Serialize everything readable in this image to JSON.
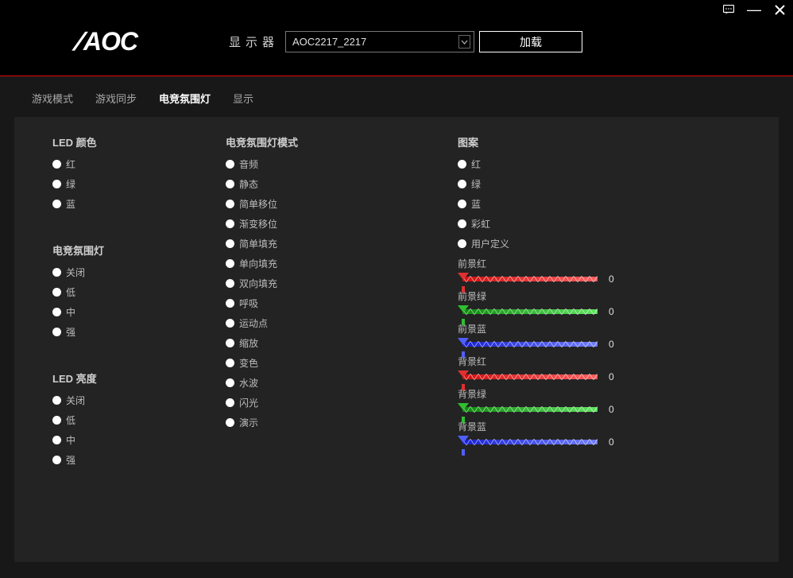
{
  "window": {
    "feedback_icon": "feedback",
    "minimize": "—",
    "close": "✕"
  },
  "header": {
    "logo": "AOC",
    "monitor_label": "显示器",
    "monitor_value": "AOC2217_2217",
    "load_button": "加载"
  },
  "tabs": [
    {
      "id": "game-mode",
      "label": "游戏模式",
      "active": false
    },
    {
      "id": "game-sync",
      "label": "游戏同步",
      "active": false
    },
    {
      "id": "light-fx",
      "label": "电竞氛围灯",
      "active": true
    },
    {
      "id": "display",
      "label": "显示",
      "active": false
    }
  ],
  "col1": {
    "led_color": {
      "title": "LED 颜色",
      "options": [
        "红",
        "绿",
        "蓝"
      ]
    },
    "light_fx": {
      "title": "电竞氛围灯",
      "options": [
        "关闭",
        "低",
        "中",
        "强"
      ]
    },
    "led_brightness": {
      "title": "LED 亮度",
      "options": [
        "关闭",
        "低",
        "中",
        "强"
      ]
    }
  },
  "col2": {
    "mode": {
      "title": "电竞氛围灯模式",
      "options": [
        "音频",
        "静态",
        "简单移位",
        "渐变移位",
        "简单填充",
        "单向填充",
        "双向填充",
        "呼吸",
        "运动点",
        "缩放",
        "变色",
        "水波",
        "闪光",
        "演示"
      ]
    }
  },
  "col3": {
    "pattern": {
      "title": "图案",
      "options": [
        "红",
        "绿",
        "蓝",
        "彩虹",
        "用户定义"
      ]
    },
    "sliders": [
      {
        "id": "fg-red",
        "label": "前景红",
        "value": "0",
        "color": "red"
      },
      {
        "id": "fg-green",
        "label": "前景绿",
        "value": "0",
        "color": "green"
      },
      {
        "id": "fg-blue",
        "label": "前景蓝",
        "value": "0",
        "color": "blue"
      },
      {
        "id": "bg-red",
        "label": "背景红",
        "value": "0",
        "color": "red"
      },
      {
        "id": "bg-green",
        "label": "背景绿",
        "value": "0",
        "color": "green"
      },
      {
        "id": "bg-blue",
        "label": "背景蓝",
        "value": "0",
        "color": "blue"
      }
    ]
  }
}
